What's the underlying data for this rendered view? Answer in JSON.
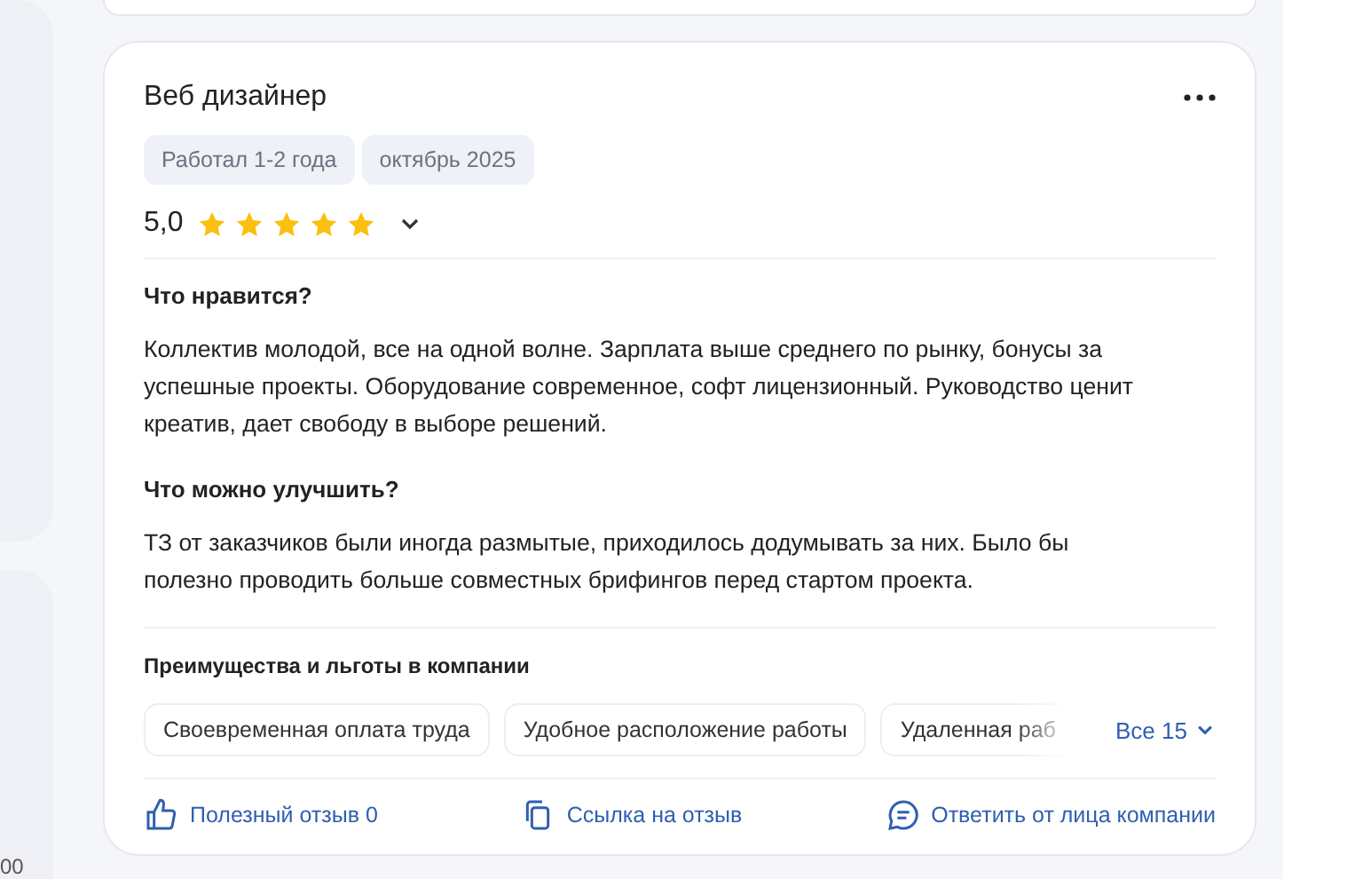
{
  "sidebar": {
    "footer_text": "00"
  },
  "review": {
    "title": "Веб дизайнер",
    "tags": [
      "Работал 1-2 года",
      "октябрь 2025"
    ],
    "rating": "5,0",
    "stars": 5,
    "sections": [
      {
        "heading": "Что нравится?",
        "text": "Коллектив молодой, все на одной волне. Зарплата выше среднего по рынку, бонусы за успешные проекты. Оборудование современное, софт лицензионный. Руководство ценит креатив, дает свободу в выборе решений."
      },
      {
        "heading": "Что можно улучшить?",
        "text": "ТЗ от заказчиков были иногда размытые, приходилось додумывать за них. Было бы полезно проводить больше совместных брифингов перед стартом проекта."
      }
    ],
    "benefits_heading": "Преимущества и льготы в компании",
    "benefits": [
      "Своевременная оплата труда",
      "Удобное расположение работы",
      "Удаленная раб"
    ],
    "all_benefits": "Все 15",
    "actions": [
      {
        "kind": "like",
        "label": "Полезный отзыв 0"
      },
      {
        "kind": "link",
        "label": "Ссылка на отзыв"
      },
      {
        "kind": "reply",
        "label": "Ответить от лица компании"
      }
    ]
  }
}
